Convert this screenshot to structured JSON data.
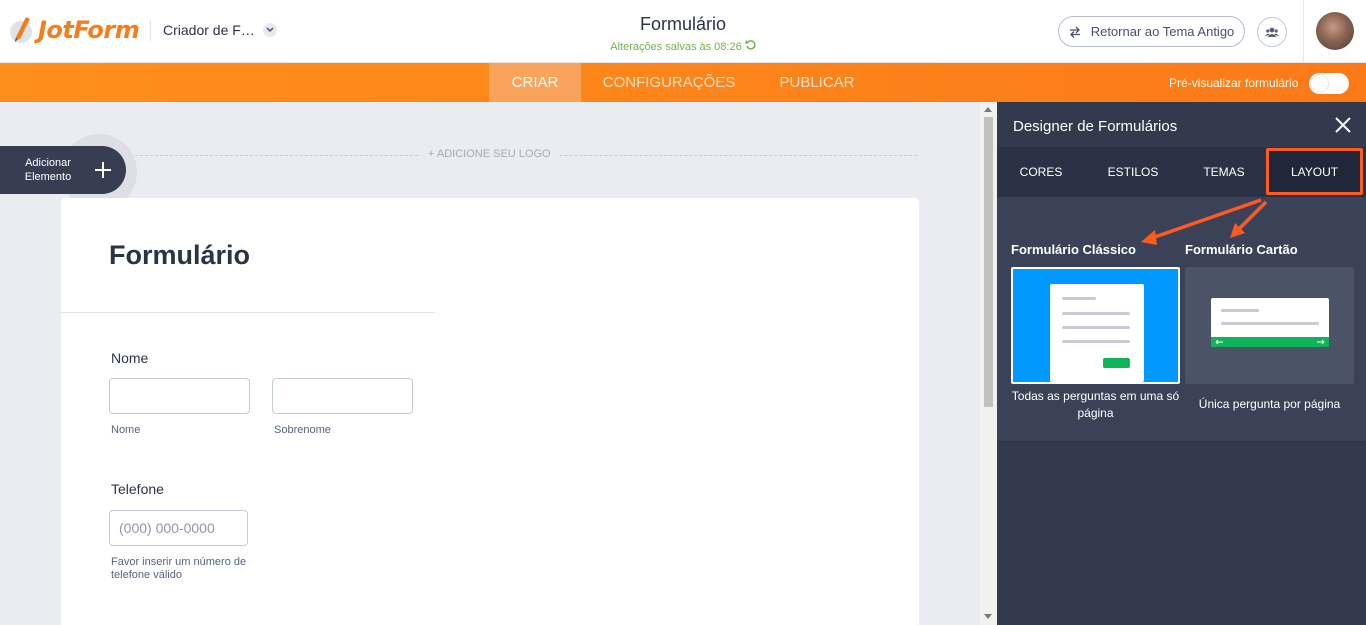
{
  "header": {
    "logo_text": "JotForm",
    "form_selector": "Criador de F…",
    "title": "Formulário",
    "saved_status": "Alterações salvas às 08:26",
    "revert_button": "Retornar ao Tema Antigo"
  },
  "nav": {
    "tabs": [
      {
        "label": "CRIAR",
        "active": true
      },
      {
        "label": "CONFIGURAÇÕES",
        "active": false
      },
      {
        "label": "PUBLICAR",
        "active": false
      }
    ],
    "preview_label": "Pré-visualizar formulário",
    "preview_enabled": false
  },
  "canvas": {
    "add_logo": "+ ADICIONE SEU LOGO",
    "add_element": "Adicionar Elemento",
    "form": {
      "heading": "Formulário",
      "name_label": "Nome",
      "first_sublabel": "Nome",
      "last_sublabel": "Sobrenome",
      "phone_label": "Telefone",
      "phone_placeholder": "(000) 000-0000",
      "phone_sublabel": "Favor inserir um número de telefone válido"
    }
  },
  "panel": {
    "title": "Designer de Formulários",
    "tabs": [
      "CORES",
      "ESTILOS",
      "TEMAS",
      "LAYOUT"
    ],
    "active_tab": "LAYOUT",
    "layouts": [
      {
        "title": "Formulário Clássico",
        "caption": "Todas as perguntas em uma só página",
        "selected": true
      },
      {
        "title": "Formulário Cartão",
        "caption": "Única pergunta por página",
        "selected": false
      }
    ]
  },
  "colors": {
    "brand_orange": "#ff8f1c",
    "panel_bg": "#333a4e",
    "highlight": "#ff5a1f",
    "classic_selected": "#0099ff",
    "card_button": "#0fb35a"
  }
}
